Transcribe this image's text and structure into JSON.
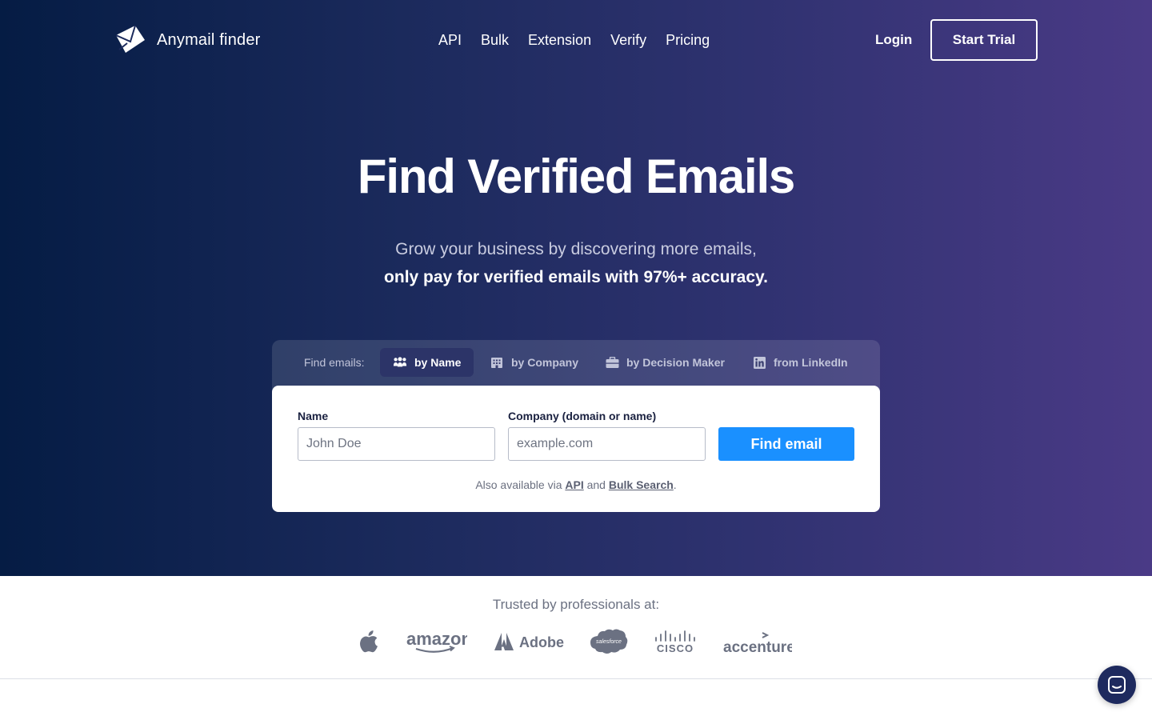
{
  "header": {
    "brand": "Anymail finder",
    "nav": [
      "API",
      "Bulk",
      "Extension",
      "Verify",
      "Pricing"
    ],
    "login": "Login",
    "start_trial": "Start Trial"
  },
  "hero": {
    "title": "Find Verified Emails",
    "subtitle_line1": "Grow your business by discovering more emails,",
    "subtitle_line2": "only pay for verified emails with 97%+ accuracy."
  },
  "search": {
    "tabs_label": "Find emails:",
    "tabs": [
      {
        "label": "by Name",
        "icon": "people-icon",
        "active": true
      },
      {
        "label": "by Company",
        "icon": "building-icon",
        "active": false
      },
      {
        "label": "by Decision Maker",
        "icon": "briefcase-icon",
        "active": false
      },
      {
        "label": "from LinkedIn",
        "icon": "linkedin-icon",
        "active": false
      }
    ],
    "name_label": "Name",
    "name_placeholder": "John Doe",
    "company_label": "Company (domain or name)",
    "company_placeholder": "example.com",
    "submit": "Find email",
    "also_prefix": "Also available via",
    "also_api": "API",
    "also_and": "and",
    "also_bulk": "Bulk Search",
    "also_suffix": "."
  },
  "trusted": {
    "title": "Trusted by professionals at:",
    "logos": [
      "apple",
      "amazon",
      "Adobe",
      "salesforce",
      "CISCO",
      "accenture"
    ]
  },
  "colors": {
    "accent": "#1a90ff",
    "hero_start": "#051c44",
    "hero_end": "#4a3a86"
  }
}
